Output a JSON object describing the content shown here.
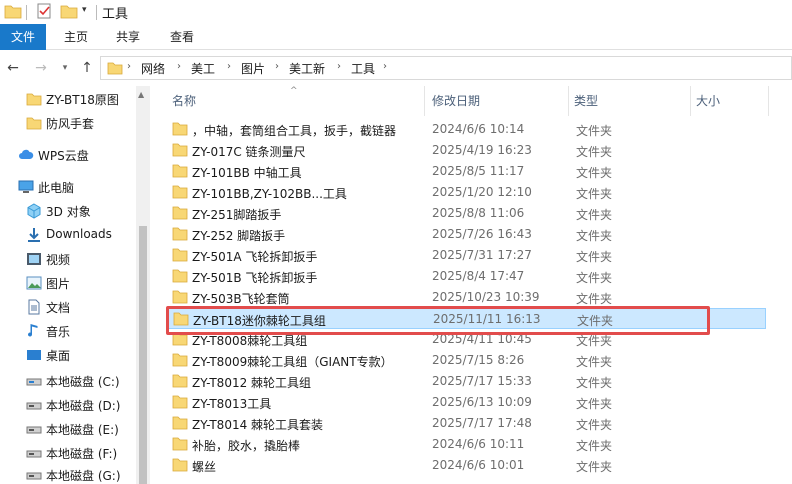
{
  "window": {
    "title": "工具"
  },
  "ribbon": {
    "tabs": [
      "文件",
      "主页",
      "共享",
      "查看"
    ]
  },
  "address": {
    "crumbs": [
      "网络",
      "美工",
      "图片",
      "美工新",
      "工具"
    ]
  },
  "navpane": {
    "items": [
      {
        "label": "ZY-BT18原图",
        "icon": "folder-icon"
      },
      {
        "label": "防风手套",
        "icon": "folder-icon"
      },
      {
        "label": "WPS云盘",
        "icon": "cloud-icon"
      },
      {
        "label": "此电脑",
        "icon": "computer-icon"
      },
      {
        "label": "3D 对象",
        "icon": "cube-icon"
      },
      {
        "label": "Downloads",
        "icon": "download-icon"
      },
      {
        "label": "视频",
        "icon": "video-icon"
      },
      {
        "label": "图片",
        "icon": "picture-icon"
      },
      {
        "label": "文档",
        "icon": "document-icon"
      },
      {
        "label": "音乐",
        "icon": "music-icon"
      },
      {
        "label": "桌面",
        "icon": "desktop-icon"
      },
      {
        "label": "本地磁盘 (C:)",
        "icon": "drive-icon"
      },
      {
        "label": "本地磁盘 (D:)",
        "icon": "drive-icon"
      },
      {
        "label": "本地磁盘 (E:)",
        "icon": "drive-icon"
      },
      {
        "label": "本地磁盘 (F:)",
        "icon": "drive-icon"
      },
      {
        "label": "本地磁盘 (G:)",
        "icon": "drive-icon"
      }
    ]
  },
  "list": {
    "columns": {
      "name": "名称",
      "date": "修改日期",
      "type": "类型",
      "size": "大小"
    },
    "rows": [
      {
        "name": "，中轴，套筒组合工具，扳手，截链器",
        "date": "2024/6/6 10:14",
        "type": "文件夹"
      },
      {
        "name": "ZY-017C  链条测量尺",
        "date": "2025/4/19 16:23",
        "type": "文件夹"
      },
      {
        "name": "ZY-101BB  中轴工具",
        "date": "2025/8/5 11:17",
        "type": "文件夹"
      },
      {
        "name": "ZY-101BB,ZY-102BB...工具",
        "date": "2025/1/20 12:10",
        "type": "文件夹"
      },
      {
        "name": "ZY-251脚踏扳手",
        "date": "2025/8/8 11:06",
        "type": "文件夹"
      },
      {
        "name": "ZY-252 脚踏扳手",
        "date": "2025/7/26 16:43",
        "type": "文件夹"
      },
      {
        "name": "ZY-501A  飞轮拆卸扳手",
        "date": "2025/7/31 17:27",
        "type": "文件夹"
      },
      {
        "name": "ZY-501B 飞轮拆卸扳手",
        "date": "2025/8/4 17:47",
        "type": "文件夹"
      },
      {
        "name": "ZY-503B飞轮套筒",
        "date": "2025/10/23 10:39",
        "type": "文件夹"
      },
      {
        "name": "ZY-BT18迷你棘轮工具组",
        "date": "2025/11/11 16:13",
        "type": "文件夹",
        "selected": true
      },
      {
        "name": "ZY-T8008棘轮工具组",
        "date": "2025/4/11 10:45",
        "type": "文件夹"
      },
      {
        "name": "ZY-T8009棘轮工具组（GIANT专款）",
        "date": "2025/7/15 8:26",
        "type": "文件夹"
      },
      {
        "name": "ZY-T8012 棘轮工具组",
        "date": "2025/7/17 15:33",
        "type": "文件夹"
      },
      {
        "name": "ZY-T8013工具",
        "date": "2025/6/13 10:09",
        "type": "文件夹"
      },
      {
        "name": "ZY-T8014 棘轮工具套装",
        "date": "2025/7/17 17:48",
        "type": "文件夹"
      },
      {
        "name": "补胎，胶水，撬胎棒",
        "date": "2024/6/6 10:11",
        "type": "文件夹"
      },
      {
        "name": "螺丝",
        "date": "2024/6/6 10:01",
        "type": "文件夹"
      }
    ]
  },
  "colors": {
    "accent": "#1979ca",
    "selection": "#cce8ff",
    "highlight": "#e24c4c",
    "folder": "#f8d775"
  }
}
